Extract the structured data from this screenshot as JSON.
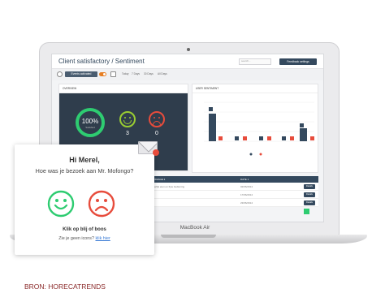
{
  "app": {
    "title": "Client satisfactory / Sentiment",
    "search_placeholder": "search...",
    "primary_button": "Feedback settings",
    "toggle_label": "Events activated",
    "ranges": [
      "Today",
      "7 Days",
      "30 Days",
      "All Days"
    ],
    "overview_label": "OVERVIEW",
    "overview_score": "100%",
    "overview_score_sub": "Satisfied",
    "happy_count": "3",
    "sad_count": "0",
    "chart_title": "USER SENTIMENT",
    "table_headers": [
      "MESSAGE 1",
      "DATE 1"
    ],
    "table_rows": [
      {
        "message": "Heerlijk eten en fijne bediening",
        "date": "02/06/2014",
        "action": "Details"
      },
      {
        "message": "—",
        "date": "17/06/2014",
        "action": "Details"
      },
      {
        "message": "—",
        "date": "23/06/2014",
        "action": "Details"
      }
    ],
    "colors": {
      "accent": "#34495e",
      "happy": "#2ecc71",
      "sad": "#e74c3c",
      "toggle": "#e67e22"
    }
  },
  "laptop": {
    "model": "MacBook Air"
  },
  "popup": {
    "greeting": "Hi Merel,",
    "question": "Hoe was je bezoek aan Mr. Mofongo?",
    "instruction": "Klik op blij of boos",
    "hint_prefix": "Zie je geen icons?",
    "hint_link": "klik hier"
  },
  "caption": "BRON: HORECATRENDS"
}
